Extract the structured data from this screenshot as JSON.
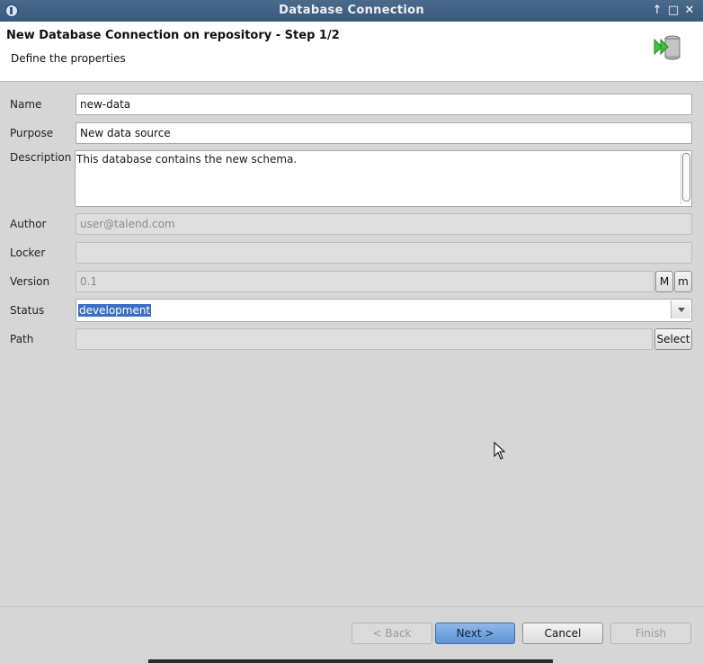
{
  "window": {
    "title": "Database Connection",
    "controls": [
      "↑",
      "□",
      "✕"
    ]
  },
  "header": {
    "title": "New Database Connection on repository - Step 1/2",
    "subtitle": "Define the properties",
    "icon": "database-import-icon"
  },
  "form": {
    "name": {
      "label": "Name",
      "value": "new-data"
    },
    "purpose": {
      "label": "Purpose",
      "value": "New data source"
    },
    "description": {
      "label": "Description",
      "value": "This database contains the new schema."
    },
    "author": {
      "label": "Author",
      "value": "user@talend.com"
    },
    "locker": {
      "label": "Locker",
      "value": ""
    },
    "version": {
      "label": "Version",
      "value": "0.1",
      "major_button": "M",
      "minor_button": "m"
    },
    "status": {
      "label": "Status",
      "value": "development"
    },
    "path": {
      "label": "Path",
      "value": "",
      "select_button": "Select"
    }
  },
  "footer": {
    "back": "< Back",
    "next": "Next >",
    "cancel": "Cancel",
    "finish": "Finish"
  },
  "colors": {
    "titlebar": "#3f5f82",
    "selection": "#3b6fc2",
    "primary_button": "#6a9fdc",
    "db_icon_arrow": "#3cc43c"
  }
}
